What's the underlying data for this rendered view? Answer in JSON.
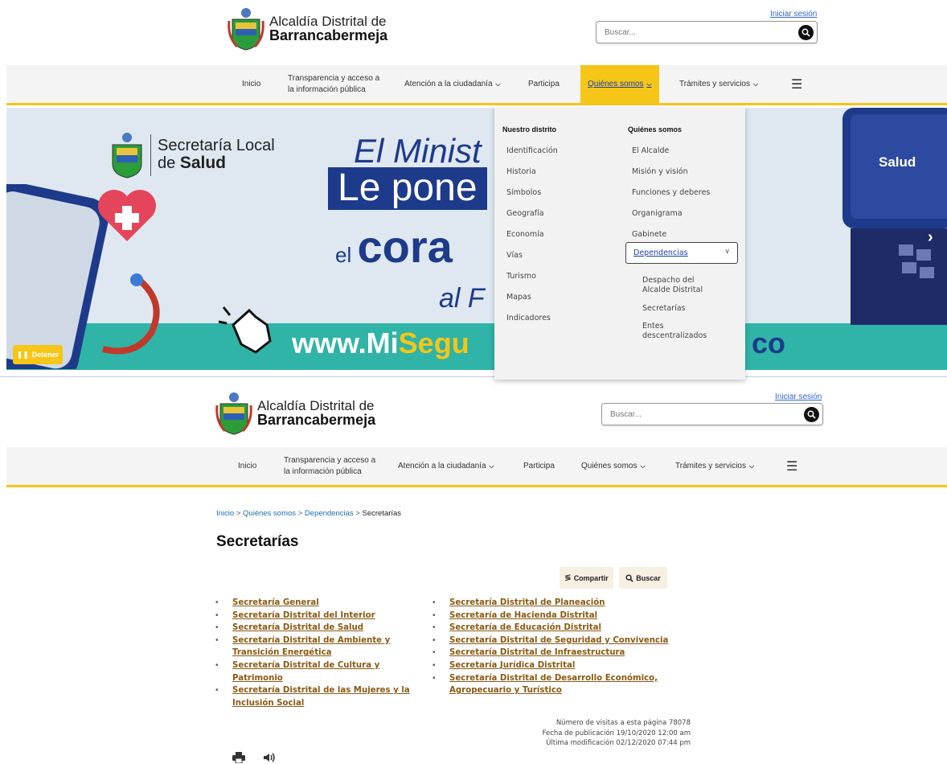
{
  "header": {
    "logo_line1": "Alcaldía Distrital de",
    "logo_line2": "Barrancabermeja",
    "login": "Iniciar sesión",
    "search_placeholder": "Buscar..."
  },
  "nav": {
    "items": [
      {
        "label": "Inicio"
      },
      {
        "label_l1": "Transparencia y acceso a",
        "label_l2": "la información pública"
      },
      {
        "label": "Atención a la ciudadanía"
      },
      {
        "label": "Participa"
      },
      {
        "label": "Quiénes somos"
      },
      {
        "label": "Trámites y servicios"
      }
    ],
    "menu_icon": "hamburger-icon"
  },
  "banner": {
    "secretaria_l1": "Secretaría Local",
    "secretaria_l2a": "de ",
    "secretaria_l2b": "Salud",
    "crest_caption": "Alcaldía Distrital de Barrancabermeja",
    "headline1": "El Minist",
    "headline2": "Le pone",
    "headline3a": "el ",
    "headline3b": "cora",
    "headline4": "al F",
    "url_a": "www.Mi",
    "url_b": "Segu",
    "url_end": "co",
    "salud_right": "Salud",
    "stop_label": "Detener"
  },
  "mega_menu": {
    "col1_title": "Nuestro distrito",
    "col1_items": [
      "Identificación",
      "Historia",
      "Símbolos",
      "Geografía",
      "Economía",
      "Vías",
      "Turismo",
      "Mapas",
      "Indicadores"
    ],
    "col2_title": "Quiénes somos",
    "col2_items": [
      "El Alcalde",
      "Misión y visión",
      "Funciones y deberes",
      "Organigrama",
      "Gabinete"
    ],
    "dependencias": "Dependencias",
    "dep_sub": [
      {
        "l1": "Despacho del",
        "l2": "Alcalde Distrital"
      },
      {
        "l1": "Secretarías",
        "l2": ""
      },
      {
        "l1": "Entes",
        "l2": "descentralizados"
      }
    ]
  },
  "breadcrumb": {
    "items": [
      "Inicio",
      "Quiénes somos",
      "Dependencias"
    ],
    "current": "Secretarías",
    "sep": ">"
  },
  "page_title": "Secretarías",
  "actions": {
    "share": "Compartir",
    "search": "Buscar"
  },
  "secretarias_col1": [
    "Secretaría General",
    "Secretaría Distrital del Interior",
    "Secretaría Distrital de Salud",
    "Secretaría Distrital de Ambiente y Transición Energética",
    "Secretaría Distrital de Cultura y Patrimonio",
    "Secretaría Distrital de las Mujeres y la Inclusión Social"
  ],
  "secretarias_col2": [
    "Secretaría Distrital de Planeación",
    "Secretaría de Hacienda Distrital",
    "Secretaría de Educación Distrital",
    "Secretaría Distrital de Seguridad y Convivencia",
    "Secretaría Distrital de Infraestructura",
    "Secretaría Jurídica Distrital",
    "Secretaría Distrital de Desarrollo Económico, Agropecuario y Turístico"
  ],
  "page_meta": {
    "visits": "Número de visitas a esta página 78078",
    "published": "Fecha de publicación 19/10/2020 12:00 am",
    "modified": "Última modificación 02/12/2020 07:44 pm"
  },
  "colors": {
    "accent": "#f5c518",
    "link": "#8b5a14",
    "navy": "#1e3a8a"
  }
}
